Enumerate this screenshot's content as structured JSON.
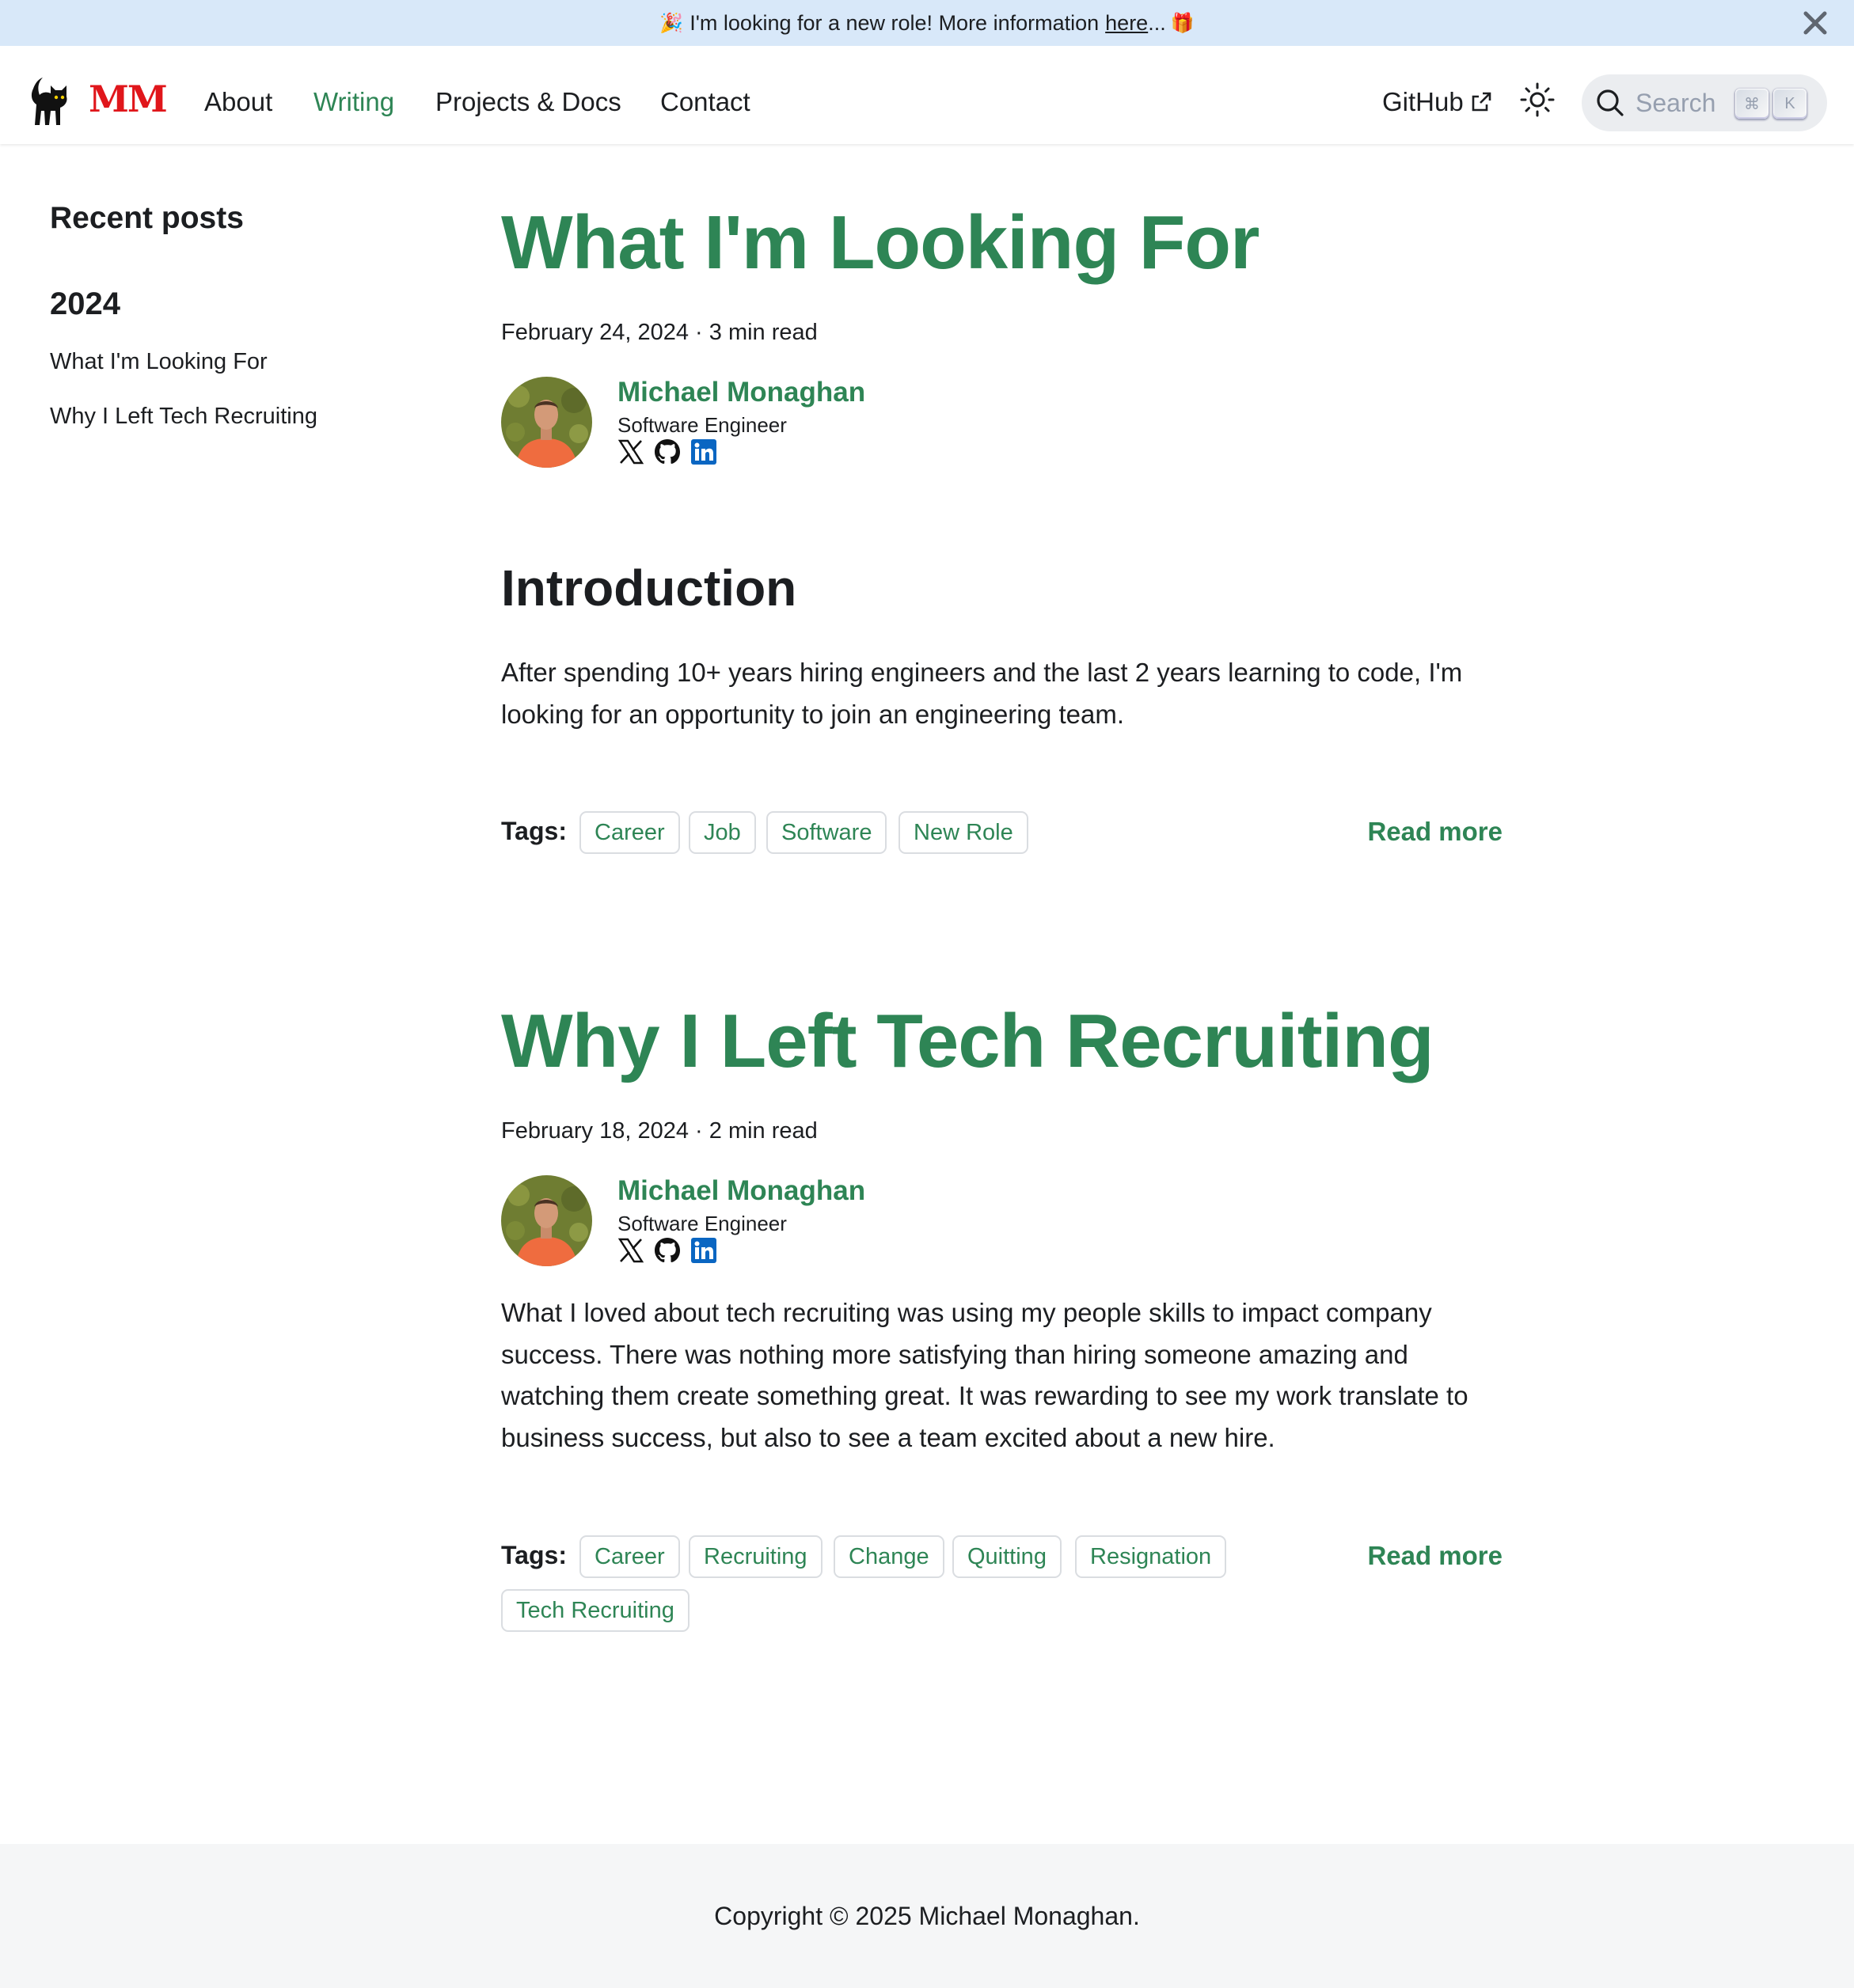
{
  "announcement": {
    "text": "I'm looking for a new role! More information",
    "link_text": "here",
    "trailing": "...",
    "emoji_left": "🎉",
    "emoji_right": "🎁"
  },
  "navbar": {
    "logo_text": "MM",
    "links": [
      "About",
      "Writing",
      "Projects & Docs",
      "Contact"
    ],
    "active": "Writing",
    "github_label": "GitHub",
    "search_placeholder": "Search",
    "kbd_cmd": "⌘",
    "kbd_k": "K"
  },
  "sidebar": {
    "title": "Recent posts",
    "year": "2024",
    "items": [
      "What I'm Looking For",
      "Why I Left Tech Recruiting"
    ]
  },
  "posts": [
    {
      "title": "What I'm Looking For",
      "meta": "February 24, 2024 · 3 min read",
      "author": {
        "name": "Michael Monaghan",
        "title": "Software Engineer"
      },
      "heading": "Introduction",
      "body": "After spending 10+ years hiring engineers and the last 2 years learning to code, I'm looking for an opportunity to join an engineering team.",
      "tags_label": "Tags:",
      "tags": [
        "Career",
        "Job",
        "Software",
        "New Role"
      ],
      "read_more": "Read more"
    },
    {
      "title": "Why I Left Tech Recruiting",
      "meta": "February 18, 2024 · 2 min read",
      "author": {
        "name": "Michael Monaghan",
        "title": "Software Engineer"
      },
      "body": "What I loved about tech recruiting was using my people skills to impact company success. There was nothing more satisfying than hiring someone amazing and watching them create something great. It was rewarding to see my work translate to business success, but also to see a team excited about a new hire.",
      "tags_label": "Tags:",
      "tags": [
        "Career",
        "Recruiting",
        "Change",
        "Quitting",
        "Resignation",
        "Tech Recruiting"
      ],
      "read_more": "Read more"
    }
  ],
  "footer": {
    "text": "Copyright © 2025 Michael Monaghan."
  },
  "colors": {
    "accent": "#2e8555",
    "announce_bg": "#d8e8f9",
    "logo_red": "#e0161b",
    "footer_bg": "#f5f6f7"
  },
  "icons": [
    "cat-logo-icon",
    "external-link-icon",
    "sun-icon",
    "search-icon",
    "close-icon",
    "x-twitter-icon",
    "github-icon",
    "linkedin-icon"
  ]
}
